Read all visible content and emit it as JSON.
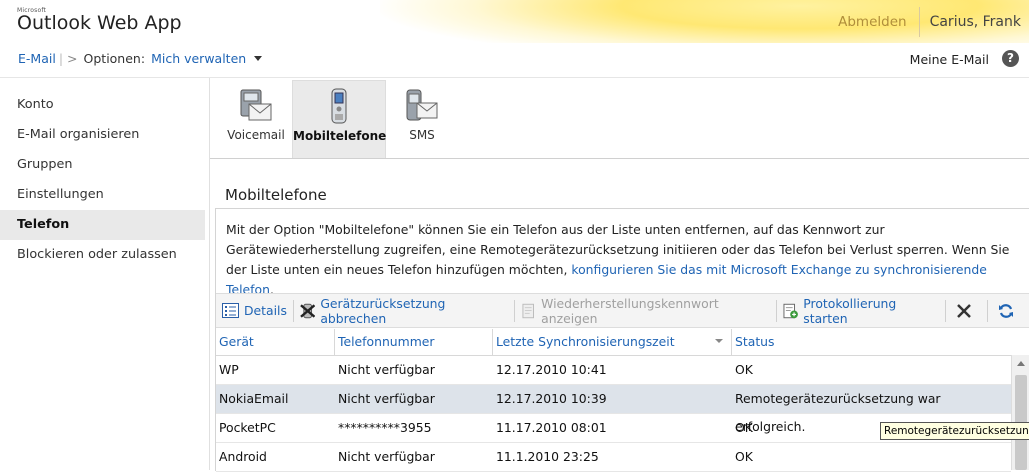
{
  "header": {
    "logo_small": "Microsoft",
    "logo_name": "Outlook Web App",
    "signout": "Abmelden",
    "user": "Carius, Frank"
  },
  "breadcrumb": {
    "root": "E-Mail",
    "separator": ">",
    "options_label": "Optionen:",
    "current": "Mich verwalten"
  },
  "my_mail": "Meine E-Mail",
  "help_label": "?",
  "nav": {
    "items": [
      {
        "label": "Konto"
      },
      {
        "label": "E-Mail organisieren"
      },
      {
        "label": "Gruppen"
      },
      {
        "label": "Einstellungen"
      },
      {
        "label": "Telefon",
        "active": true
      },
      {
        "label": "Blockieren oder zulassen"
      }
    ]
  },
  "tabs": [
    {
      "label": "Voicemail",
      "icon": "voicemail-icon"
    },
    {
      "label": "Mobiltelefone",
      "icon": "mobile-phone-icon",
      "active": true
    },
    {
      "label": "SMS",
      "icon": "sms-icon"
    }
  ],
  "section_title": "Mobiltelefone",
  "description": {
    "text": "Mit der Option \"Mobiltelefone\" können Sie ein Telefon aus der Liste unten entfernen, auf das Kennwort zur Gerätewiederherstellung zugreifen, eine Remotegerätezurücksetzung initiieren oder das Telefon bei Verlust sperren. Wenn Sie der Liste unten ein neues Telefon hinzufügen möchten, ",
    "link": "konfigurieren Sie das mit Microsoft Exchange zu synchronisierende Telefon",
    "end": "."
  },
  "toolbar": {
    "details": "Details",
    "cancel_wipe": "Gerätzurücksetzung abbrechen",
    "show_recovery": "Wiederherstellungskennwort anzeigen",
    "start_logging": "Protokollierung starten"
  },
  "grid": {
    "headers": [
      "Gerät",
      "Telefonnummer",
      "Letzte Synchronisierungszeit",
      "Status"
    ],
    "rows": [
      [
        "WP",
        "Nicht verfügbar",
        "12.17.2010 10:41",
        "OK"
      ],
      [
        "NokiaEmail",
        "Nicht verfügbar",
        "12.17.2010 10:39",
        "Remotegerätezurücksetzung war erfolgreich."
      ],
      [
        "PocketPC",
        "**********3955",
        "11.17.2010 08:01",
        "OK"
      ],
      [
        "Android",
        "Nicht verfügbar",
        "11.1.2010 23:25",
        "OK"
      ]
    ]
  },
  "tooltip": "Remotegerätezurücksetzung w",
  "colors": {
    "link": "#1f64b4",
    "selected_row": "#dde3ea",
    "signout": "#b08e3a"
  }
}
